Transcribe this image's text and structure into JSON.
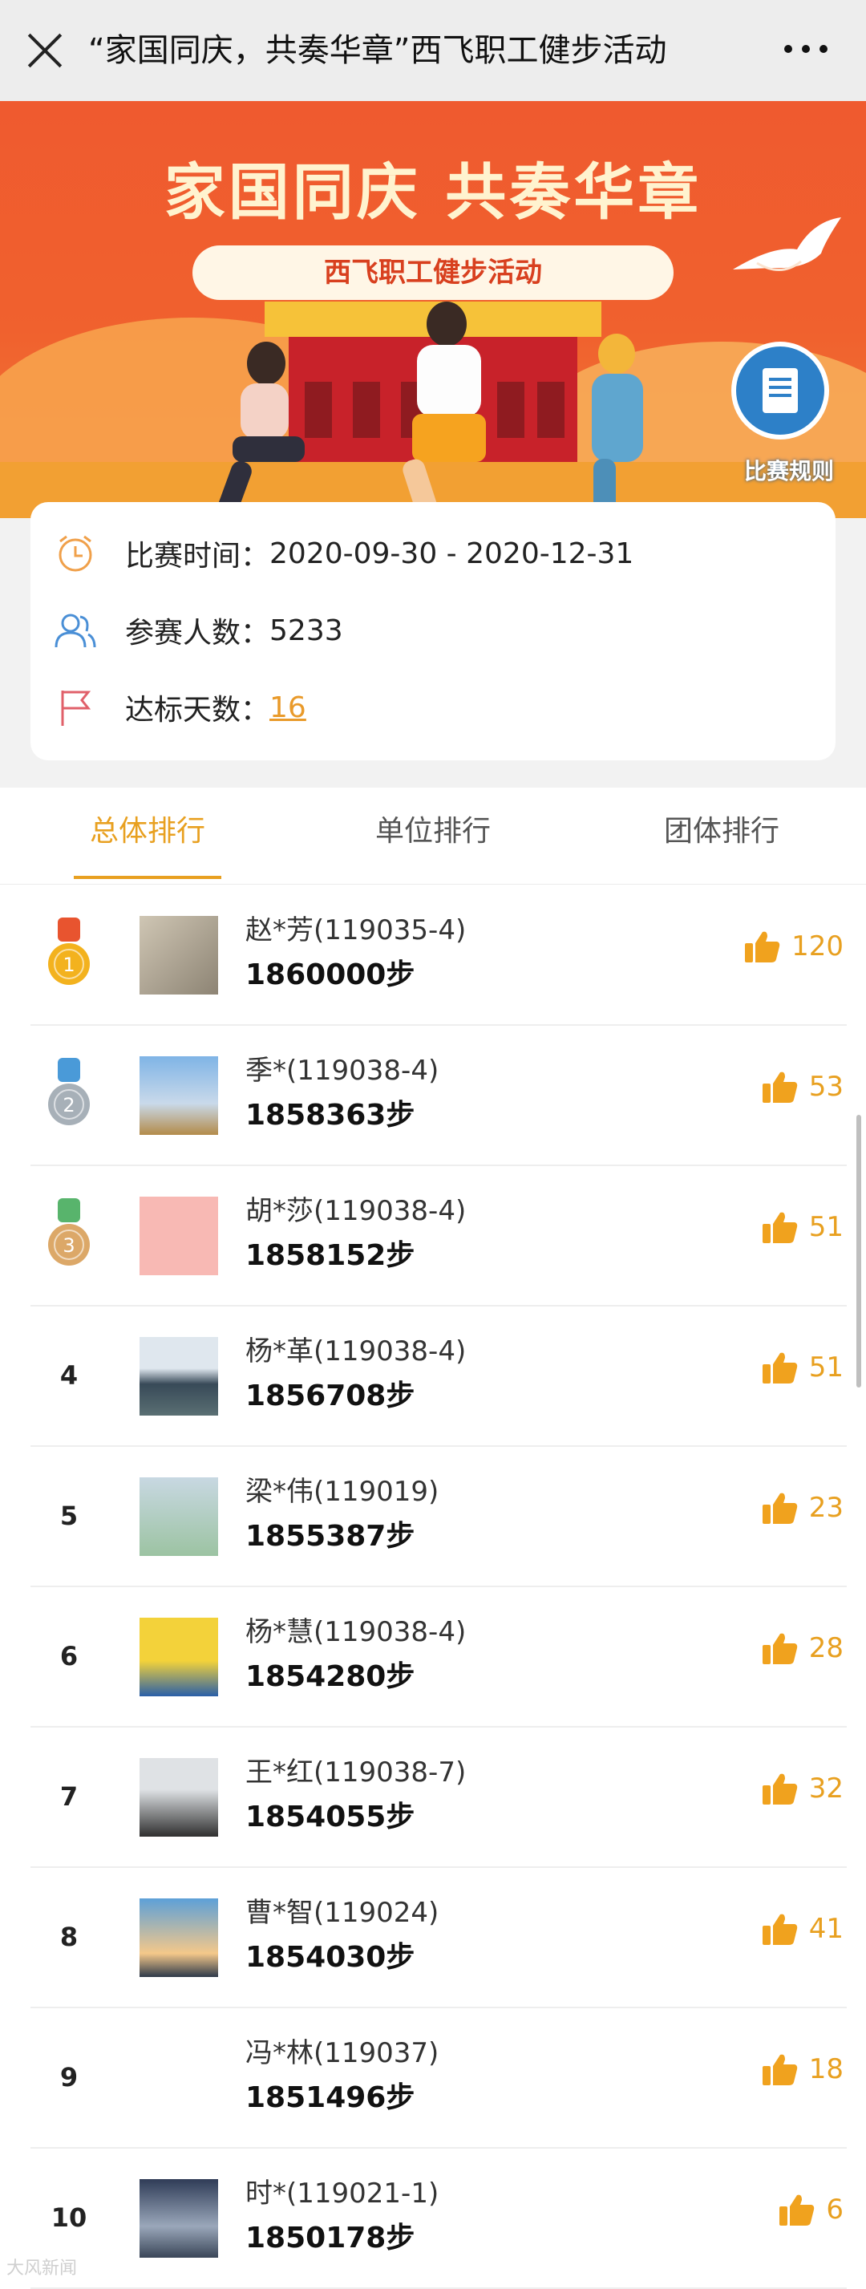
{
  "header": {
    "title": "“家国同庆，共奏华章”西飞职工健步活动"
  },
  "banner": {
    "headline": "家国同庆  共奏华章",
    "subtitle": "西飞职工健步活动",
    "rules_label": "比赛规则"
  },
  "info": {
    "time_label": "比赛时间：",
    "time_value": "2020-09-30 - 2020-12-31",
    "participants_label": "参赛人数：",
    "participants_value": "5233",
    "days_label": "达标天数：",
    "days_value": "16"
  },
  "tabs": [
    {
      "label": "总体排行",
      "active": true
    },
    {
      "label": "单位排行",
      "active": false
    },
    {
      "label": "团体排行",
      "active": false
    }
  ],
  "rankings": [
    {
      "rank": "1",
      "name": "赵*芳(119035-4)",
      "steps": "1860000步",
      "likes": "120",
      "avatar": "calligraphy-avatar"
    },
    {
      "rank": "2",
      "name": "季*(119038-4)",
      "steps": "1858363步",
      "likes": "53",
      "avatar": "pampas-grass-avatar"
    },
    {
      "rank": "3",
      "name": "胡*莎(119038-4)",
      "steps": "1858152步",
      "likes": "51",
      "avatar": "strawberry-avatar"
    },
    {
      "rank": "4",
      "name": "杨*革(119038-4)",
      "steps": "1856708步",
      "likes": "51",
      "avatar": "lake-avatar"
    },
    {
      "rank": "5",
      "name": "梁*伟(119019)",
      "steps": "1855387步",
      "likes": "23",
      "avatar": "eagle-avatar"
    },
    {
      "rank": "6",
      "name": "杨*慧(119038-4)",
      "steps": "1854280步",
      "likes": "28",
      "avatar": "graduate-avatar"
    },
    {
      "rank": "7",
      "name": "王*红(119038-7)",
      "steps": "1854055步",
      "likes": "32",
      "avatar": "tree-avatar"
    },
    {
      "rank": "8",
      "name": "曹*智(119024)",
      "steps": "1854030步",
      "likes": "41",
      "avatar": "sunset-avatar"
    },
    {
      "rank": "9",
      "name": "冯*林(119037)",
      "steps": "1851496步",
      "likes": "18",
      "avatar": "calligraphy-feng-avatar"
    },
    {
      "rank": "10",
      "name": "时*(119021-1)",
      "steps": "1850178步",
      "likes": "6",
      "avatar": "corridor-avatar"
    }
  ],
  "colors": {
    "accent": "#e8a020",
    "banner": "#ef5a2f",
    "gold": "#f3b21e",
    "silver": "#9aa4ad",
    "bronze": "#d8a35c"
  },
  "watermark": "大风新闻"
}
